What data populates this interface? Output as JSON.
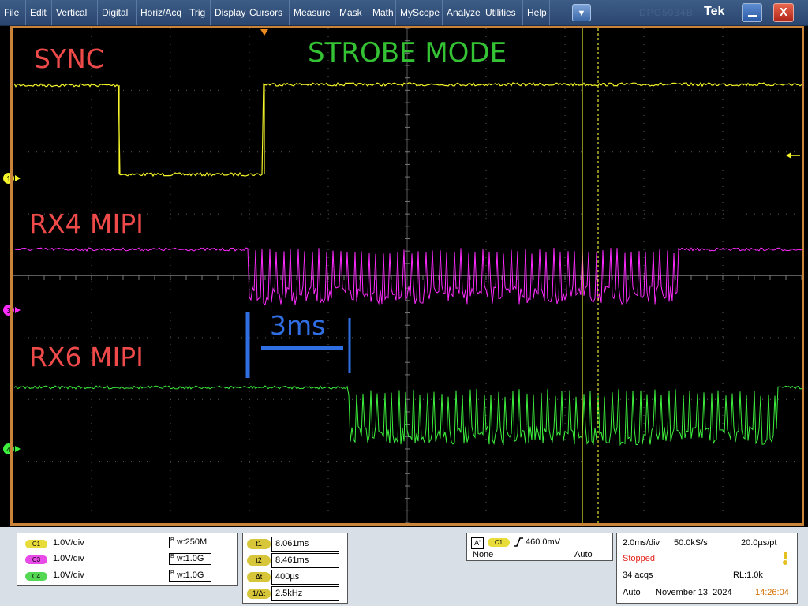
{
  "menu": {
    "items": [
      "File",
      "Edit",
      "Vertical",
      "Digital",
      "Horiz/Acq",
      "Trig",
      "Display",
      "Cursors",
      "Measure",
      "Mask",
      "Math",
      "MyScope",
      "Analyze",
      "Utilities",
      "Help"
    ],
    "expand_icon": "chevron-down-icon",
    "ghost_text": "DPO5034B",
    "brand": "Tek",
    "minimize_icon": "minimize-icon",
    "close_icon": "close-icon"
  },
  "annotations": {
    "sync": "SYNC",
    "mode": "STROBE MODE",
    "rx4": "RX4 MIPI",
    "rx6": "RX6 MIPI",
    "span": "3ms"
  },
  "markers": {
    "ch1": "1",
    "ch3": "3",
    "ch4": "4"
  },
  "colors": {
    "ch1": "#f5f52a",
    "ch3": "#ff2cff",
    "ch4": "#3df03d",
    "cursor": "#e6e62e",
    "annotation_red": "#ef4a4a",
    "annotation_green": "#34c234",
    "annotation_blue": "#2f6fe3"
  },
  "vertical": {
    "channels": [
      {
        "tag": "C1",
        "scale": "1.0V/div",
        "bw": "250M",
        "color": "#e8dc3a"
      },
      {
        "tag": "C3",
        "scale": "1.0V/div",
        "bw": "1.0G",
        "color": "#e84ae8"
      },
      {
        "tag": "C4",
        "scale": "1.0V/div",
        "bw": "1.0G",
        "color": "#54d854"
      }
    ],
    "bw_prefix": "B",
    "bw_suffix": "W"
  },
  "cursors": {
    "rows": [
      {
        "label": "t1",
        "value": "8.061ms"
      },
      {
        "label": "t2",
        "value": "8.461ms"
      },
      {
        "label": "Δt",
        "value": "400µs"
      },
      {
        "label": "1/Δt",
        "value": "2.5kHz"
      }
    ]
  },
  "trigger": {
    "source_tag": "A'",
    "channel": "C1",
    "slope_icon": "rising-edge-icon",
    "level": "460.0mV",
    "coupling": "None",
    "mode": "Auto"
  },
  "horizontal": {
    "scale": "2.0ms/div",
    "sample_rate": "50.0kS/s",
    "resolution": "20.0µs/pt",
    "state": "Stopped",
    "acqs": "34 acqs",
    "record_length": "RL:1.0k",
    "acq_mode": "Auto",
    "date": "November 13, 2024",
    "time": "14:26:04"
  }
}
